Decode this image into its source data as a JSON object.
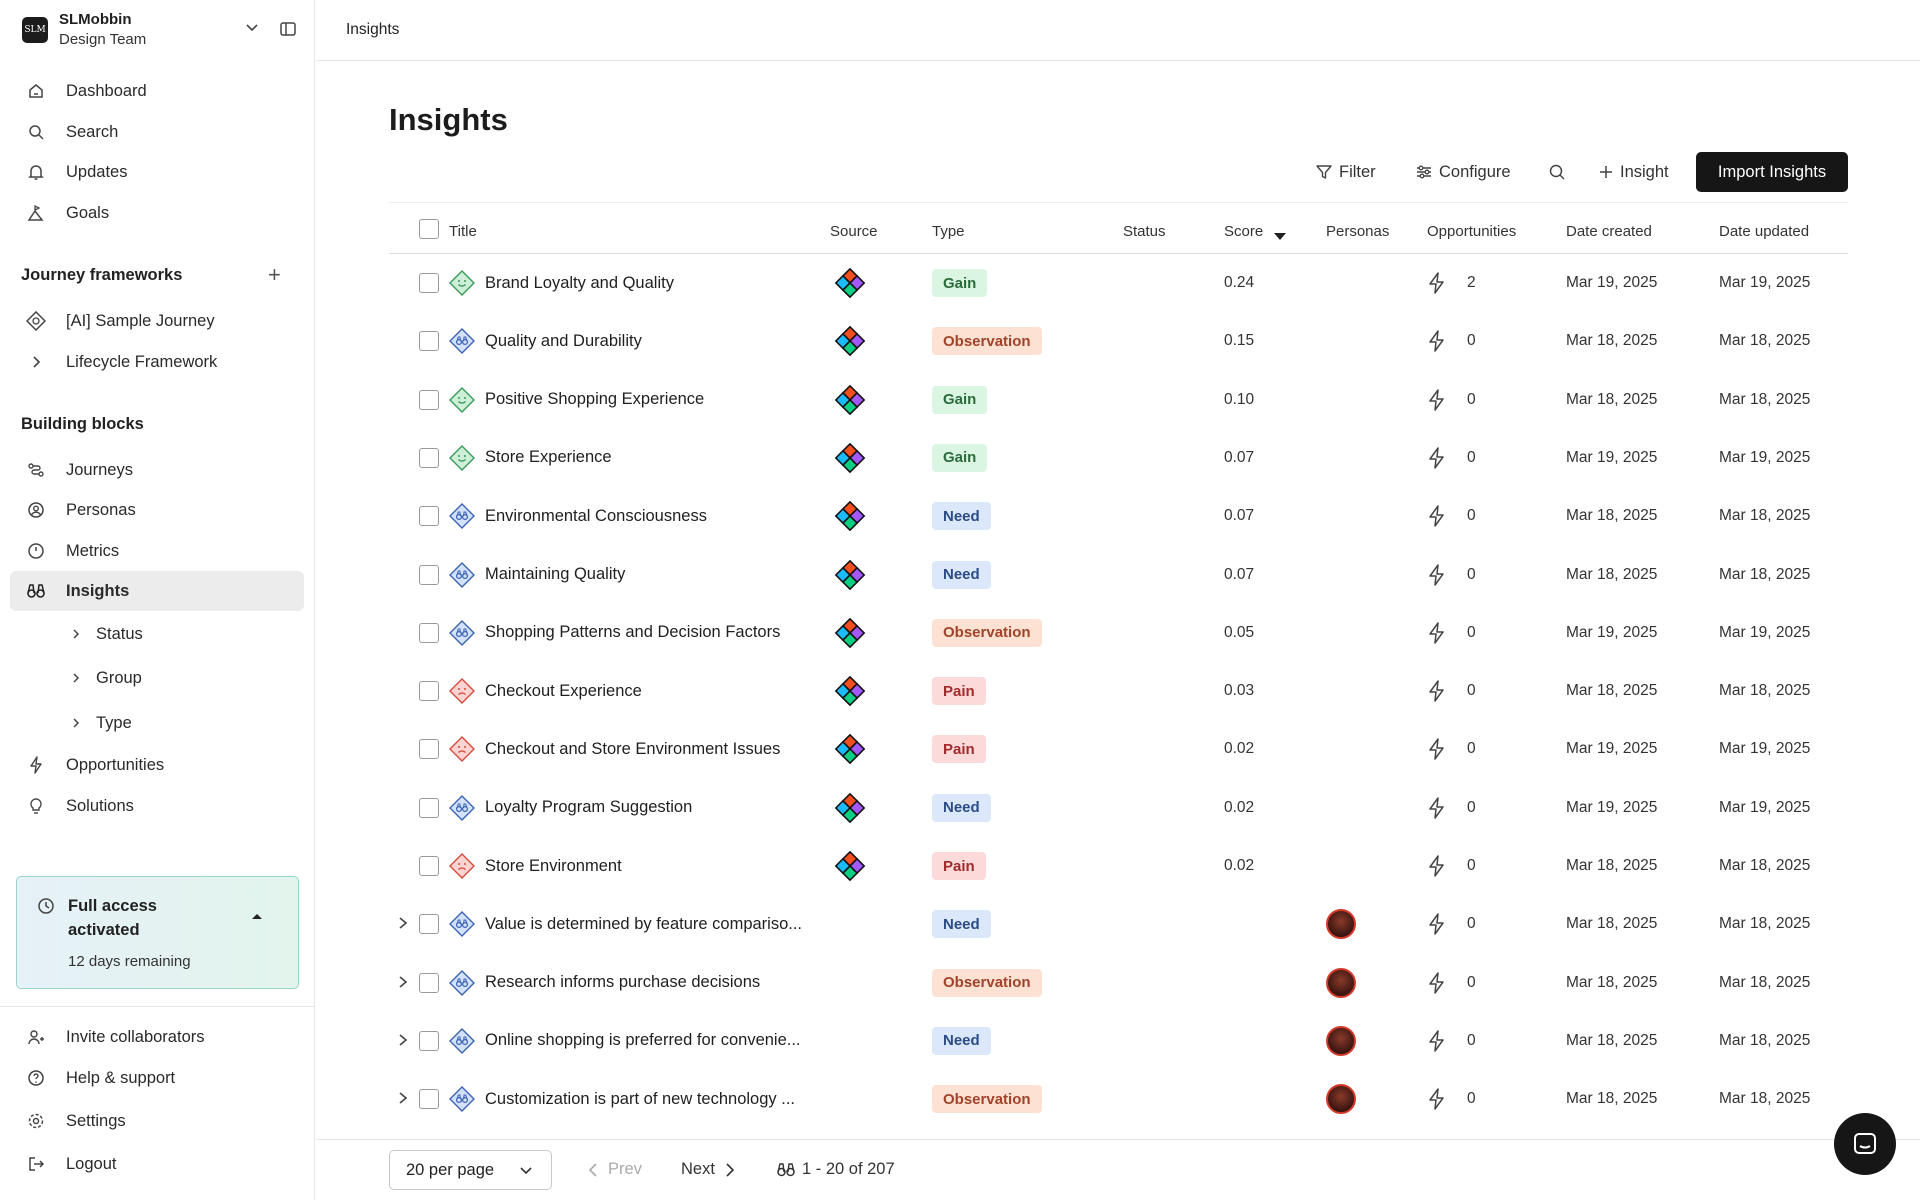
{
  "workspace": {
    "logo_text": "SLM",
    "name": "SLMobbin",
    "team": "Design Team"
  },
  "nav": {
    "dashboard": "Dashboard",
    "search": "Search",
    "updates": "Updates",
    "goals": "Goals",
    "journey_frameworks_title": "Journey frameworks",
    "sample_journey": "[AI] Sample Journey",
    "lifecycle_framework": "Lifecycle Framework",
    "building_blocks_title": "Building blocks",
    "journeys": "Journeys",
    "personas": "Personas",
    "metrics": "Metrics",
    "insights": "Insights",
    "status": "Status",
    "group": "Group",
    "type": "Type",
    "opportunities": "Opportunities",
    "solutions": "Solutions",
    "invite": "Invite collaborators",
    "help": "Help & support",
    "settings": "Settings",
    "logout": "Logout"
  },
  "trial": {
    "title": "Full access activated",
    "remaining": "12 days remaining"
  },
  "breadcrumb": "Insights",
  "page_title": "Insights",
  "toolbar": {
    "filter": "Filter",
    "configure": "Configure",
    "add_insight": "Insight",
    "import": "Import Insights"
  },
  "columns": {
    "title": "Title",
    "source": "Source",
    "type": "Type",
    "status": "Status",
    "score": "Score",
    "personas": "Personas",
    "opportunities": "Opportunities",
    "date_created": "Date created",
    "date_updated": "Date updated"
  },
  "rows": [
    {
      "title": "Brand Loyalty and Quality",
      "icon": "gain-face-icon",
      "source": "figma-icon",
      "type": "Gain",
      "score": "0.24",
      "opps": "2",
      "created": "Mar 19, 2025",
      "updated": "Mar 19, 2025"
    },
    {
      "title": "Quality and Durability",
      "icon": "insight-binoculars-icon",
      "source": "figma-icon",
      "type": "Observation",
      "score": "0.15",
      "opps": "0",
      "created": "Mar 18, 2025",
      "updated": "Mar 18, 2025"
    },
    {
      "title": "Positive Shopping Experience",
      "icon": "gain-face-icon",
      "source": "figma-icon",
      "type": "Gain",
      "score": "0.10",
      "opps": "0",
      "created": "Mar 18, 2025",
      "updated": "Mar 18, 2025"
    },
    {
      "title": "Store Experience",
      "icon": "gain-face-icon",
      "source": "figma-icon",
      "type": "Gain",
      "score": "0.07",
      "opps": "0",
      "created": "Mar 19, 2025",
      "updated": "Mar 19, 2025"
    },
    {
      "title": "Environmental Consciousness",
      "icon": "insight-binoculars-icon",
      "source": "figma-icon",
      "type": "Need",
      "score": "0.07",
      "opps": "0",
      "created": "Mar 18, 2025",
      "updated": "Mar 18, 2025"
    },
    {
      "title": "Maintaining Quality",
      "icon": "insight-binoculars-icon",
      "source": "figma-icon",
      "type": "Need",
      "score": "0.07",
      "opps": "0",
      "created": "Mar 18, 2025",
      "updated": "Mar 18, 2025"
    },
    {
      "title": "Shopping Patterns and Decision Factors",
      "icon": "insight-binoculars-icon",
      "source": "figma-icon",
      "type": "Observation",
      "score": "0.05",
      "opps": "0",
      "created": "Mar 19, 2025",
      "updated": "Mar 19, 2025"
    },
    {
      "title": "Checkout Experience",
      "icon": "pain-face-icon",
      "source": "figma-icon",
      "type": "Pain",
      "score": "0.03",
      "opps": "0",
      "created": "Mar 18, 2025",
      "updated": "Mar 18, 2025"
    },
    {
      "title": "Checkout and Store Environment Issues",
      "icon": "pain-face-icon",
      "source": "figma-icon",
      "type": "Pain",
      "score": "0.02",
      "opps": "0",
      "created": "Mar 19, 2025",
      "updated": "Mar 19, 2025"
    },
    {
      "title": "Loyalty Program Suggestion",
      "icon": "insight-binoculars-icon",
      "source": "figma-icon",
      "type": "Need",
      "score": "0.02",
      "opps": "0",
      "created": "Mar 19, 2025",
      "updated": "Mar 19, 2025"
    },
    {
      "title": "Store Environment",
      "icon": "pain-face-icon",
      "source": "figma-icon",
      "type": "Pain",
      "score": "0.02",
      "opps": "0",
      "created": "Mar 18, 2025",
      "updated": "Mar 18, 2025"
    },
    {
      "title": "Value is determined by feature compariso...",
      "icon": "insight-binoculars-icon",
      "source": "",
      "type": "Need",
      "score": "",
      "persona": true,
      "expandable": true,
      "opps": "0",
      "created": "Mar 18, 2025",
      "updated": "Mar 18, 2025"
    },
    {
      "title": "Research informs purchase decisions",
      "icon": "insight-binoculars-icon",
      "source": "",
      "type": "Observation",
      "score": "",
      "persona": true,
      "expandable": true,
      "opps": "0",
      "created": "Mar 18, 2025",
      "updated": "Mar 18, 2025"
    },
    {
      "title": "Online shopping is preferred for convenie...",
      "icon": "insight-binoculars-icon",
      "source": "",
      "type": "Need",
      "score": "",
      "persona": true,
      "expandable": true,
      "opps": "0",
      "created": "Mar 18, 2025",
      "updated": "Mar 18, 2025"
    },
    {
      "title": "Customization is part of new technology ...",
      "icon": "insight-binoculars-icon",
      "source": "",
      "type": "Observation",
      "score": "",
      "persona": true,
      "expandable": true,
      "opps": "0",
      "created": "Mar 18, 2025",
      "updated": "Mar 18, 2025"
    }
  ],
  "pagination": {
    "per_page": "20 per page",
    "prev": "Prev",
    "next": "Next",
    "range": "1 - 20 of 207"
  },
  "colors": {
    "primary": "#161616",
    "active_nav": "#ececec",
    "gain": "#daf5e1",
    "observation": "#fde2d3",
    "need": "#dbe7fb",
    "pain": "#fddada"
  }
}
